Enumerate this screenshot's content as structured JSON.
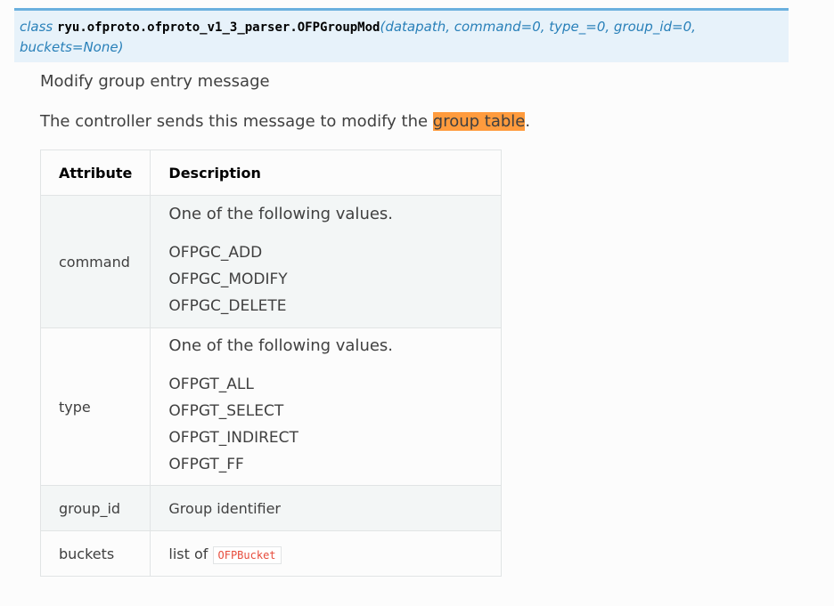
{
  "signature": {
    "keyword": "class",
    "name": "ryu.ofproto.ofproto_v1_3_parser.OFPGroupMod",
    "open_paren": "(",
    "params_line1": "datapath, command=0, type_=0, group_id=0,",
    "params_line2": "buckets=None)"
  },
  "description": {
    "summary": "Modify group entry message",
    "detail_prefix": "The controller sends this message to modify the ",
    "detail_highlight": "group table",
    "detail_suffix": "."
  },
  "table": {
    "headers": [
      "Attribute",
      "Description"
    ],
    "rows": [
      {
        "attribute": "command",
        "intro": "One of the following values.",
        "values": [
          "OFPGC_ADD",
          "OFPGC_MODIFY",
          "OFPGC_DELETE"
        ]
      },
      {
        "attribute": "type",
        "intro": "One of the following values.",
        "values": [
          "OFPGT_ALL",
          "OFPGT_SELECT",
          "OFPGT_INDIRECT",
          "OFPGT_FF"
        ]
      },
      {
        "attribute": "group_id",
        "text": "Group identifier"
      },
      {
        "attribute": "buckets",
        "text_prefix": "list of ",
        "code": "OFPBucket"
      }
    ]
  },
  "colors": {
    "signature_bg": "#e7f2fa",
    "signature_border": "#6ab0de",
    "signature_text": "#2980b9",
    "highlight": "#ff9b3d",
    "code_text": "#e74c3c",
    "table_stripe": "#f3f6f6"
  }
}
